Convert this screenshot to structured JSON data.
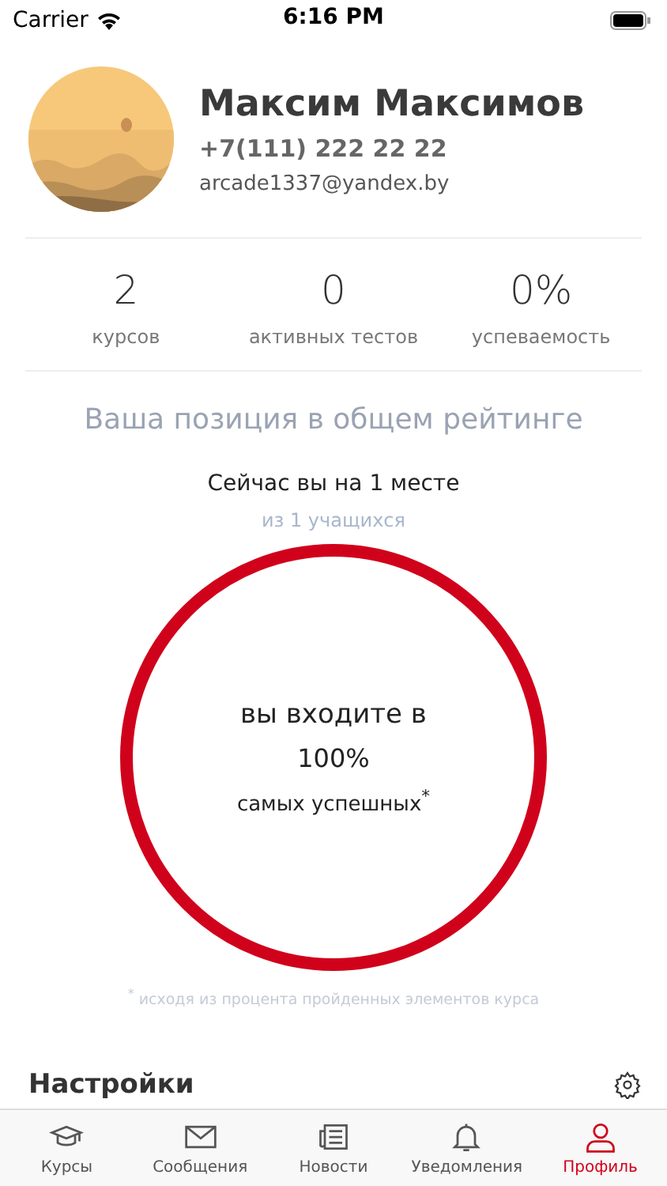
{
  "status_bar": {
    "carrier": "Carrier",
    "time": "6:16 PM"
  },
  "profile": {
    "name": "Максим Максимов",
    "phone": "+7(111) 222 22 22",
    "email": "arcade1337@yandex.by"
  },
  "stats": [
    {
      "value": "2",
      "label": "курсов"
    },
    {
      "value": "0",
      "label": "активных тестов"
    },
    {
      "value": "0%",
      "label": "успеваемость"
    }
  ],
  "rating": {
    "title": "Ваша позиция в общем рейтинге",
    "position": "Сейчас вы на 1 месте",
    "of_total": "из 1 учащихся",
    "ring_line_1": "вы входите в",
    "ring_percent": "100%",
    "ring_line_2": "самых успешных$^{*}$",
    "footnote": "$^{*}$ исходя из процента пройденных элементов курса"
  },
  "settings": {
    "title": "Настройки"
  },
  "tab_bar": [
    {
      "label": "Курсы",
      "selected": false
    },
    {
      "label": "Сообщения",
      "selected": false
    },
    {
      "label": "Новости",
      "selected": false
    },
    {
      "label": "Уведомления",
      "selected": false
    },
    {
      "label": "Профиль",
      "selected": true
    }
  ]
}
